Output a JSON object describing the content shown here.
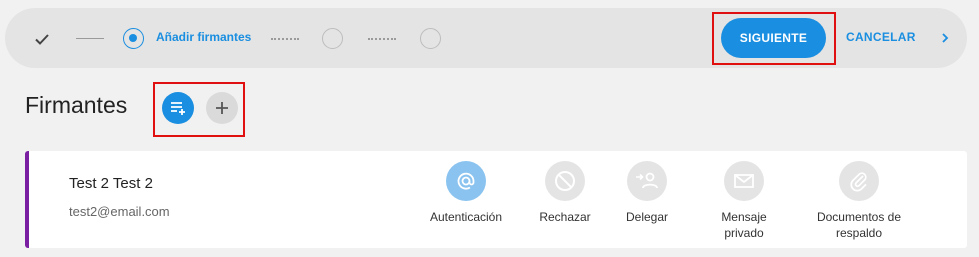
{
  "stepper": {
    "active_step_label": "Añadir firmantes",
    "next_label": "SIGUIENTE",
    "cancel_label": "CANCELAR"
  },
  "signers": {
    "title": "Firmantes"
  },
  "signer": {
    "name": "Test 2 Test 2",
    "email": "test2@email.com",
    "actions": [
      {
        "label": "Autenticación",
        "icon": "at-icon",
        "active": true
      },
      {
        "label": "Rechazar",
        "icon": "block-icon",
        "active": false
      },
      {
        "label": "Delegar",
        "icon": "delegate-person-icon",
        "active": false
      },
      {
        "label": "Mensaje privado",
        "icon": "mail-icon",
        "active": false
      },
      {
        "label": "Documentos de respaldo",
        "icon": "paperclip-icon",
        "active": false
      }
    ]
  },
  "colors": {
    "accent": "#1a8ee0",
    "signer_bar": "#7b1fa2",
    "highlight": "#e01010"
  }
}
